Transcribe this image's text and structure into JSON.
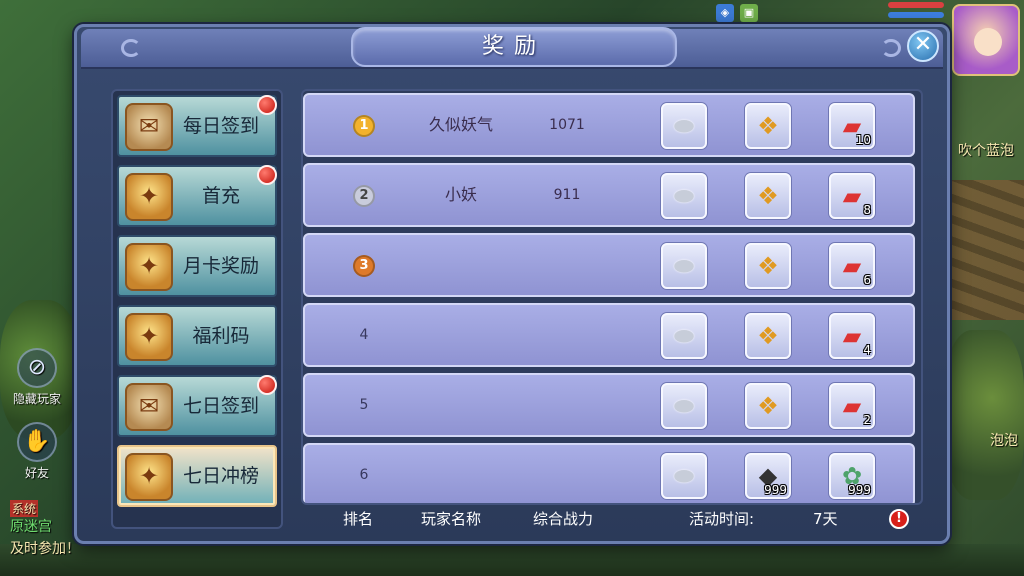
{
  "dialog": {
    "title": "奖励",
    "close_icon": "close-icon"
  },
  "tabs": [
    {
      "label": "每日签到",
      "icon": "scroll-icon",
      "badge": true,
      "active": false
    },
    {
      "label": "首充",
      "icon": "treasure-chest-icon",
      "badge": true,
      "active": false
    },
    {
      "label": "月卡奖励",
      "icon": "treasure-chest-icon",
      "badge": false,
      "active": false
    },
    {
      "label": "福利码",
      "icon": "treasure-chest-icon",
      "badge": false,
      "active": false
    },
    {
      "label": "七日签到",
      "icon": "scroll-icon",
      "badge": true,
      "active": false
    },
    {
      "label": "七日冲榜",
      "icon": "treasure-chest-icon",
      "badge": false,
      "active": true
    }
  ],
  "ranking": [
    {
      "rank": "1",
      "medal": "gold",
      "name": "久似妖气",
      "power": "1071",
      "rewards": [
        {
          "icon": "silver-ingot-icon",
          "qty": ""
        },
        {
          "icon": "gold-token-icon",
          "qty": ""
        },
        {
          "icon": "red-chest-icon",
          "qty": "10"
        }
      ]
    },
    {
      "rank": "2",
      "medal": "silver",
      "name": "小妖",
      "power": "911",
      "rewards": [
        {
          "icon": "silver-ingot-icon",
          "qty": ""
        },
        {
          "icon": "gold-token-icon",
          "qty": ""
        },
        {
          "icon": "red-chest-icon",
          "qty": "8"
        }
      ]
    },
    {
      "rank": "3",
      "medal": "bronze",
      "name": "",
      "power": "",
      "rewards": [
        {
          "icon": "silver-ingot-icon",
          "qty": ""
        },
        {
          "icon": "gold-token-icon",
          "qty": ""
        },
        {
          "icon": "red-chest-icon",
          "qty": "6"
        }
      ]
    },
    {
      "rank": "4",
      "medal": "",
      "name": "",
      "power": "",
      "rewards": [
        {
          "icon": "silver-ingot-icon",
          "qty": ""
        },
        {
          "icon": "gold-token-icon",
          "qty": ""
        },
        {
          "icon": "red-chest-icon",
          "qty": "4"
        }
      ]
    },
    {
      "rank": "5",
      "medal": "",
      "name": "",
      "power": "",
      "rewards": [
        {
          "icon": "silver-ingot-icon",
          "qty": ""
        },
        {
          "icon": "gold-token-icon",
          "qty": ""
        },
        {
          "icon": "red-chest-icon",
          "qty": "2"
        }
      ]
    },
    {
      "rank": "6",
      "medal": "",
      "name": "",
      "power": "",
      "rewards": [
        {
          "icon": "silver-ingot-icon",
          "qty": ""
        },
        {
          "icon": "dark-ore-icon",
          "qty": "999"
        },
        {
          "icon": "green-herb-icon",
          "qty": "999"
        }
      ]
    }
  ],
  "footer": {
    "rank_label": "排名",
    "name_label": "玩家名称",
    "power_label": "综合战力",
    "time_label": "活动时间:",
    "time_value": "7天",
    "warn_icon": "!"
  },
  "background": {
    "hide_players_label": "隐藏玩家",
    "friends_label": "好友",
    "chat_channel": "系统",
    "chat_line1": "原迷宫",
    "chat_line2": "及时参加！",
    "right_text1": "吹个蓝泡",
    "right_text2": "泡泡"
  },
  "colors": {
    "dialog_bg": "#2b3a59",
    "row_bg": "#a9aee6",
    "tab_active_border": "#e8c48a",
    "badge_red": "#c4120b"
  }
}
